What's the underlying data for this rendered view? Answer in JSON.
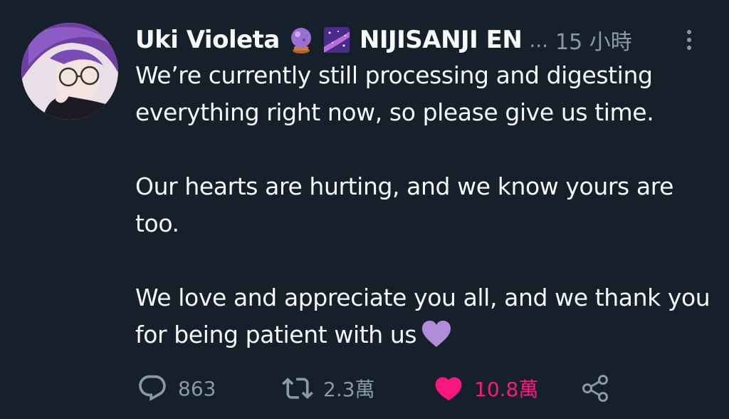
{
  "tweet": {
    "author": {
      "display_name": "Uki Violeta",
      "emoji_1": "crystal-ball-icon",
      "emoji_2": "milky-way-icon",
      "name_suffix": "NIJISANJI EN",
      "ellipsis": "...",
      "avatar_icon": "avatar"
    },
    "timestamp": "15 小時",
    "paragraphs": [
      "We’re currently still processing and digesting everything right now, so please give us time.",
      "Our hearts are hurting, and we know yours are too.",
      "We love and appreciate you all, and we thank you for being patient with us"
    ],
    "inline_emoji": "purple-heart-icon",
    "actions": {
      "replies": "863",
      "retweets": "2.3萬",
      "likes": "10.8萬",
      "liked": true
    }
  },
  "colors": {
    "background": "#15202b",
    "text": "#f7f9f9",
    "secondary": "#8b98a5",
    "like": "#f91880",
    "purple_heart": "#ae8ed8"
  }
}
